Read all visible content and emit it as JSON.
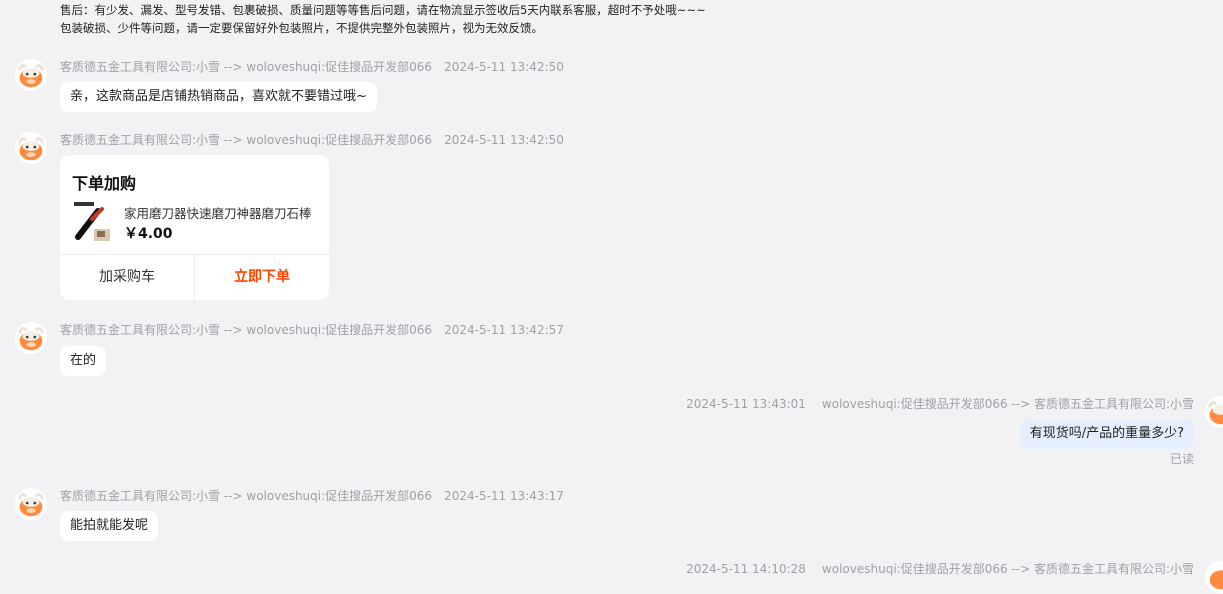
{
  "top_notice": {
    "line1": "售后：有少发、漏发、型号发错、包裹破损、质量问题等等售后问题，请在物流显示签收后5天内联系客服，超时不予处哦~~~",
    "line2": "包装破损、少件等问题，请一定要保留好外包装照片，不提供完整外包装照片，视为无效反馈。"
  },
  "messages": [
    {
      "sender": "客质德五金工具有限公司:小雪 --> woloveshuqi:促佳搜品开发部066",
      "time": "2024-5-11 13:42:50",
      "text": "亲，这款商品是店铺热销商品，喜欢就不要错过哦~"
    },
    {
      "sender": "客质德五金工具有限公司:小雪 --> woloveshuqi:促佳搜品开发部066",
      "time": "2024-5-11 13:42:50",
      "card": {
        "title": "下单加购",
        "product_name": "家用磨刀器快速磨刀神器磨刀石棒",
        "price": "￥4.00",
        "btn_cart": "加采购车",
        "btn_order": "立即下单"
      }
    },
    {
      "sender": "客质德五金工具有限公司:小雪 --> woloveshuqi:促佳搜品开发部066",
      "time": "2024-5-11 13:42:57",
      "text": "在的"
    },
    {
      "sender": "woloveshuqi:促佳搜品开发部066 --> 客质德五金工具有限公司:小雪",
      "time": "2024-5-11 13:43:01",
      "text": "有现货吗/产品的重量多少?",
      "status": "已读"
    },
    {
      "sender": "客质德五金工具有限公司:小雪 --> woloveshuqi:促佳搜品开发部066",
      "time": "2024-5-11 13:43:17",
      "text": "能拍就能发呢"
    },
    {
      "sender": "woloveshuqi:促佳搜品开发部066 --> 客质德五金工具有限公司:小雪",
      "time": "2024-5-11 14:10:28"
    }
  ],
  "colors": {
    "background": "#f2f2f5",
    "my_bubble": "#e5eefd",
    "order_accent": "#ff4400",
    "avatar_orange": "#ff8a3d"
  }
}
